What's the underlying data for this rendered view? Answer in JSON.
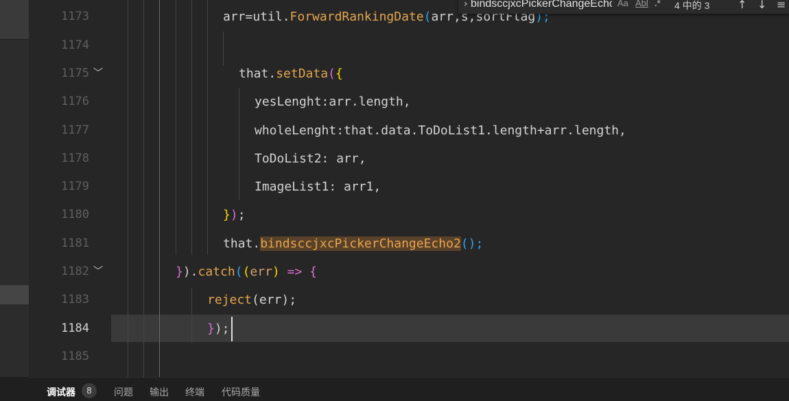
{
  "find_widget": {
    "query": "bindsccjxcPickerChangeEcho",
    "match_case_label": "Aa",
    "whole_word_label": "Abl",
    "regex_label": ".*",
    "result_count": "4 中的 3",
    "prev_icon": "arrow-up-icon",
    "next_icon": "arrow-down-icon",
    "menu_icon": "menu-icon"
  },
  "editor": {
    "lines": [
      {
        "number": "1173",
        "tokens": [
          "arr=util.",
          "ForwardRankingDate",
          "(",
          "arr,s,sortFlag",
          ");"
        ]
      },
      {
        "number": "1174"
      },
      {
        "number": "1175",
        "tokens": [
          "that.",
          "setData",
          "(",
          "{"
        ]
      },
      {
        "number": "1176",
        "tokens": [
          "yesLenght",
          ":arr.length,"
        ]
      },
      {
        "number": "1177",
        "tokens": [
          "wholeLenght",
          ":that.data.ToDoList1.length+arr.length,"
        ]
      },
      {
        "number": "1178",
        "tokens": [
          "ToDoList2",
          ": arr,"
        ]
      },
      {
        "number": "1179",
        "tokens": [
          "ImageList1",
          ": arr1,"
        ]
      },
      {
        "number": "1180",
        "tokens": [
          "}",
          ")",
          ";"
        ]
      },
      {
        "number": "1181",
        "tokens": [
          "that.",
          "bindsccjxcPickerChangeEcho2",
          "();"
        ]
      },
      {
        "number": "1182",
        "tokens": [
          "}",
          ").",
          "catch",
          "(",
          "(",
          "err",
          ")",
          " => ",
          "{"
        ]
      },
      {
        "number": "1183",
        "tokens": [
          "reject",
          "(err);"
        ]
      },
      {
        "number": "1184",
        "tokens": [
          "}",
          ");"
        ]
      },
      {
        "number": "1185"
      }
    ]
  },
  "bottom_panel": {
    "tabs": [
      {
        "label": "调试器",
        "badge": "8"
      },
      {
        "label": "问题"
      },
      {
        "label": "输出"
      },
      {
        "label": "终端"
      },
      {
        "label": "代码质量"
      }
    ]
  },
  "colors": {
    "background": "#262626",
    "current_line": "#3a3a3a",
    "function": "#e5a64f",
    "bracket_gold": "#ffd700",
    "bracket_pink": "#da70d6",
    "bracket_blue": "#2ea4f6",
    "highlight": "#5a4129"
  }
}
